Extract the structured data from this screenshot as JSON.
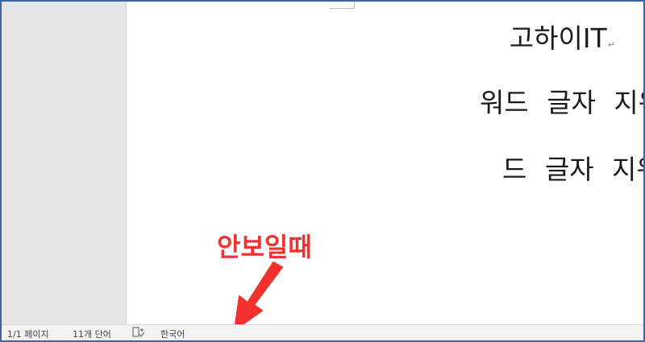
{
  "document": {
    "lines": [
      "고하이IT",
      "워드 글자 지워질 때",
      "드 글자 지워질 때 ㅎ"
    ],
    "paragraph_mark": "↵"
  },
  "annotation": {
    "text": "안보일때",
    "color": "#f2302d"
  },
  "statusbar": {
    "page_count": "1/1 페이지",
    "word_count": "11개 단어",
    "proofing_icon": "proofing-book-icon",
    "language": "한국어"
  },
  "colors": {
    "frame_border": "#3f63a8",
    "canvas": "#e6e6e6",
    "page": "#ffffff",
    "statusbar": "#f3f3f3"
  }
}
